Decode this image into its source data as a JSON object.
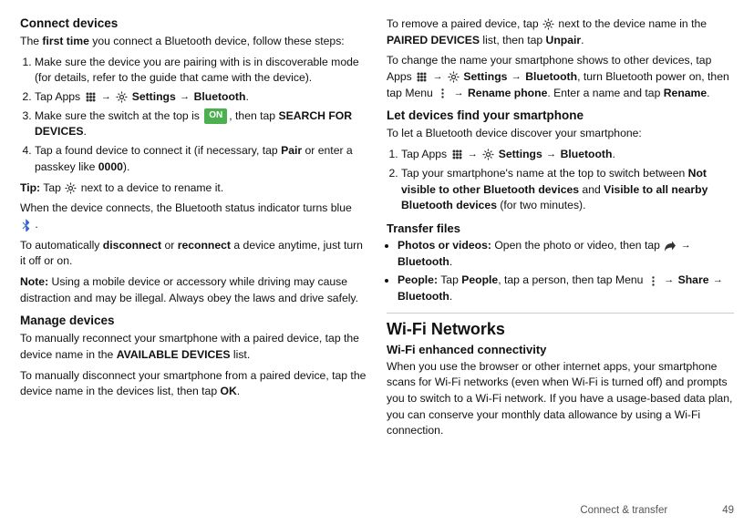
{
  "page": {
    "footer": {
      "text": "Connect & transfer",
      "page_number": "49"
    }
  },
  "left": {
    "heading": "Connect devices",
    "intro": "The first time you connect a Bluetooth device, follow these steps:",
    "steps": [
      "Make sure the device you are pairing with is in discoverable mode (for details, refer to the guide that came with the device).",
      "Tap Apps → Settings → Bluetooth.",
      "Make sure the switch at the top is ON , then tap SEARCH FOR DEVICES.",
      "Tap a found device to connect it (if necessary, tap Pair or enter a passkey like 0000)."
    ],
    "tip": "Tip: Tap next to a device to rename it.",
    "tip_detail": "When the device connects, the Bluetooth status indicator turns blue.",
    "disconnect_note": "To automatically disconnect or reconnect a device anytime, just turn it off or on.",
    "note_label": "Note:",
    "note_text": "Using a mobile device or accessory while driving may cause distraction and may be illegal. Always obey the laws and drive safely.",
    "manage_heading": "Manage devices",
    "manage_p1": "To manually reconnect your smartphone with a paired device, tap the device name in the AVAILABLE DEVICES list.",
    "manage_p2": "To manually disconnect your smartphone from a paired device, tap the device name in the devices list, then tap OK."
  },
  "right": {
    "remove_text": "To remove a paired device, tap next to the device name in the PAIRED DEVICES list, then tap Unpair.",
    "change_name_text": "To change the name your smartphone shows to other devices, tap Apps → Settings → Bluetooth, turn Bluetooth power on, then tap Menu → Rename phone. Enter a name and tap Rename.",
    "find_heading": "Let devices find your smartphone",
    "find_intro": "To let a Bluetooth device discover your smartphone:",
    "find_steps": [
      "Tap Apps → Settings → Bluetooth.",
      "Tap your smartphone's name at the top to switch between Not visible to other Bluetooth devices and Visible to all nearby Bluetooth devices (for two minutes)."
    ],
    "transfer_heading": "Transfer files",
    "transfer_items": [
      "Photos or videos: Open the photo or video, then tap → Bluetooth.",
      "People: Tap People, tap a person, then tap Menu → Share → Bluetooth."
    ],
    "wifi_heading": "Wi-Fi Networks",
    "wifi_sub": "Wi-Fi enhanced connectivity",
    "wifi_text": "When you use the browser or other internet apps, your smartphone scans for Wi-Fi networks (even when Wi-Fi is turned off) and prompts you to switch to a Wi-Fi network. If you have a usage-based data plan, you can conserve your monthly data allowance by using a Wi-Fi connection."
  }
}
